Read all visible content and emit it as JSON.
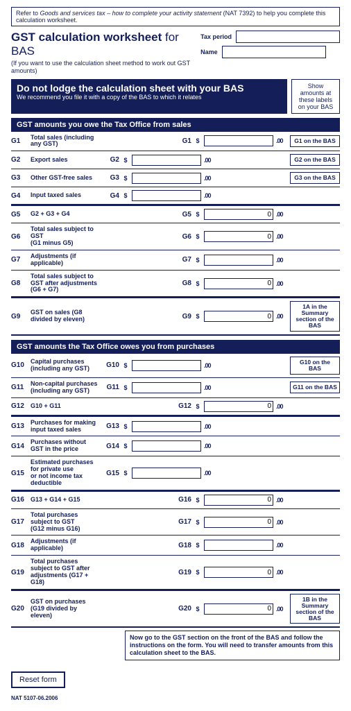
{
  "refer": {
    "prefix": "Refer to ",
    "ital": "Goods and services tax – how to complete your activity statement",
    "nat": " (NAT 7392) to help you complete this calculation worksheet."
  },
  "header": {
    "title_bold": "GST calculation worksheet",
    "title_light": " for BAS",
    "subtitle": "(If you want to use the calculation sheet method to work out GST amounts)",
    "tax_period_label": "Tax period",
    "name_label": "Name",
    "tax_period": "",
    "name": ""
  },
  "banner": {
    "title": "Do not lodge the calculation sheet with your BAS",
    "sub": "We recommend you file it with a copy of the BAS to which it relates"
  },
  "side_box": "Show amounts at these labels on your BAS",
  "sections": {
    "owe": "GST amounts you owe the Tax Office from sales",
    "owed": "GST amounts the Tax Office owes you from purchases"
  },
  "cents": ".00",
  "rows_owe": [
    {
      "code": "G1",
      "label": "Total sales (including any GST)",
      "fcode": "G1",
      "side": "left-dummy",
      "right_val": "",
      "bas": "G1 on the BAS"
    },
    {
      "code": "G2",
      "label": "Export sales",
      "fcode": "G2",
      "side": "left",
      "left_val": "",
      "bas": "G2 on the BAS"
    },
    {
      "code": "G3",
      "label": "Other GST-free sales",
      "fcode": "G3",
      "side": "left",
      "left_val": "",
      "bas": "G3 on the BAS"
    },
    {
      "code": "G4",
      "label": "Input taxed sales",
      "fcode": "G4",
      "side": "left",
      "left_val": "",
      "bas": ""
    },
    {
      "code": "G5",
      "label": "G2 + G3 + G4",
      "fcode": "G5",
      "side": "right",
      "right_val": "0",
      "bas": ""
    },
    {
      "code": "G6",
      "label": "Total sales subject to GST\n(G1 minus G5)",
      "fcode": "G6",
      "side": "right",
      "right_val": "0",
      "bas": ""
    },
    {
      "code": "G7",
      "label": "Adjustments (if applicable)",
      "fcode": "G7",
      "side": "right",
      "right_val": "",
      "bas": ""
    },
    {
      "code": "G8",
      "label": "Total sales subject to GST after adjustments\n(G6 + G7)",
      "fcode": "G8",
      "side": "right",
      "right_val": "0",
      "bas": ""
    },
    {
      "code": "G9",
      "label": "GST on sales (G8 divided by eleven)",
      "fcode": "G9",
      "side": "right",
      "right_val": "0",
      "bas": "1A in the Summary section of the BAS"
    }
  ],
  "rows_owed": [
    {
      "code": "G10",
      "label": "Capital purchases\n(including any GST)",
      "fcode": "G10",
      "side": "left",
      "left_val": "",
      "bas": "G10 on the BAS"
    },
    {
      "code": "G11",
      "label": "Non-capital purchases\n(including any GST)",
      "fcode": "G11",
      "side": "left",
      "left_val": "",
      "bas": "G11 on the BAS"
    },
    {
      "code": "G12",
      "label": "G10 + G11",
      "fcode": "G12",
      "side": "right",
      "right_val": "0",
      "bas": ""
    },
    {
      "code": "G13",
      "label": "Purchases for making input taxed sales",
      "fcode": "G13",
      "side": "left",
      "left_val": "",
      "bas": ""
    },
    {
      "code": "G14",
      "label": "Purchases without GST in the price",
      "fcode": "G14",
      "side": "left",
      "left_val": "",
      "bas": ""
    },
    {
      "code": "G15",
      "label": "Estimated purchases for private use\nor not income tax deductible",
      "fcode": "G15",
      "side": "left",
      "left_val": "",
      "bas": ""
    },
    {
      "code": "G16",
      "label": "G13 + G14 + G15",
      "fcode": "G16",
      "side": "right",
      "right_val": "0",
      "bas": ""
    },
    {
      "code": "G17",
      "label": "Total purchases subject to GST\n(G12 minus G16)",
      "fcode": "G17",
      "side": "right",
      "right_val": "0",
      "bas": ""
    },
    {
      "code": "G18",
      "label": "Adjustments (if applicable)",
      "fcode": "G18",
      "side": "right",
      "right_val": "",
      "bas": ""
    },
    {
      "code": "G19",
      "label": "Total purchases subject to GST after adjustments (G17 + G18)",
      "fcode": "G19",
      "side": "right",
      "right_val": "0",
      "bas": ""
    },
    {
      "code": "G20",
      "label": "GST on purchases (G19 divided by eleven)",
      "fcode": "G20",
      "side": "right",
      "right_val": "0",
      "bas": "1B in the Summary section of the BAS"
    }
  ],
  "footer_note": "Now go to the GST section on the front of the BAS and follow the instructions on the form. You will need to transfer amounts from this calculation sheet to the BAS.",
  "reset": "Reset form",
  "nat": "NAT 5107-06.2006"
}
